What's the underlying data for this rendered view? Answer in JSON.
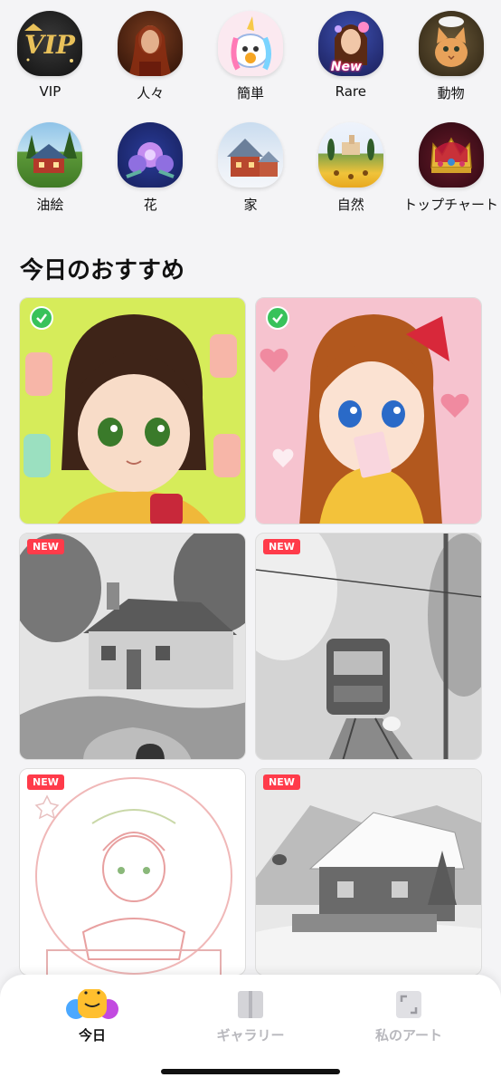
{
  "categories": [
    {
      "label": "VIP",
      "icon": "vip-icon"
    },
    {
      "label": "人々",
      "icon": "people-icon"
    },
    {
      "label": "簡単",
      "icon": "easy-unicorn-icon"
    },
    {
      "label": "Rare",
      "icon": "rare-icon",
      "tag": "New"
    },
    {
      "label": "動物",
      "icon": "animal-kitten-icon"
    },
    {
      "label": "油絵",
      "icon": "oil-painting-icon"
    },
    {
      "label": "花",
      "icon": "flower-icon"
    },
    {
      "label": "家",
      "icon": "house-icon"
    },
    {
      "label": "自然",
      "icon": "nature-icon"
    },
    {
      "label": "トップチャート",
      "icon": "top-chart-crown-icon"
    }
  ],
  "section": {
    "title": "今日のおすすめ"
  },
  "feed": [
    {
      "subject": "anime girl with peach drinks",
      "status": "completed"
    },
    {
      "subject": "anime girl with letter and hearts",
      "status": "completed"
    },
    {
      "subject": "cottage with garden and bridge",
      "badge": "NEW"
    },
    {
      "subject": "tram through cherry blossoms",
      "badge": "NEW"
    },
    {
      "subject": "girl in snow globe",
      "badge": "NEW"
    },
    {
      "subject": "snowy cabin in winter",
      "badge": "NEW"
    }
  ],
  "nav": {
    "tabs": [
      {
        "label": "今日",
        "active": true
      },
      {
        "label": "ギャラリー",
        "active": false
      },
      {
        "label": "私のアート",
        "active": false
      }
    ]
  },
  "colors": {
    "new_badge": "#ff3b4a",
    "done_badge": "#38c25a",
    "inactive_tab": "#b8b8bd"
  }
}
